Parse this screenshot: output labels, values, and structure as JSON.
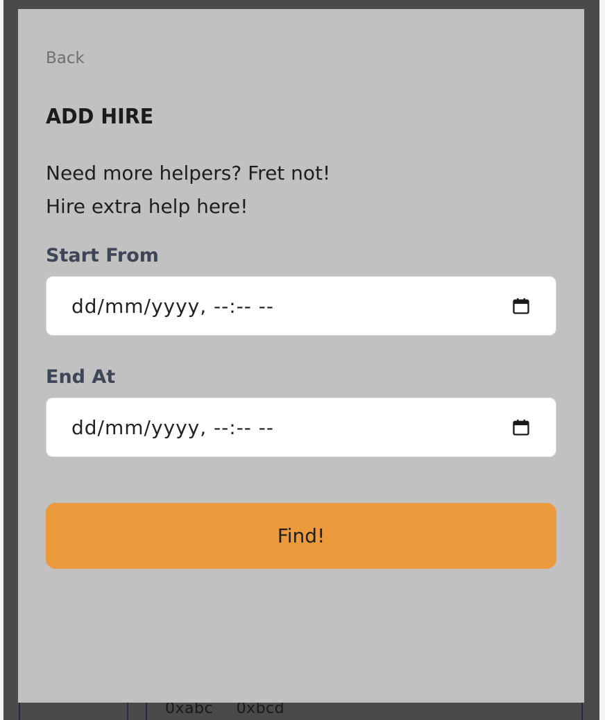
{
  "modal": {
    "back_label": "Back",
    "title": "ADD HIRE",
    "description_line1": "Need more helpers? Fret not!",
    "description_line2": "Hire extra help here!",
    "start_label": "Start From",
    "start_value": "dd/mm/yyyy, --:-- --",
    "end_label": "End At",
    "end_value": "dd/mm/yyyy, --:-- --",
    "find_label": "Find!",
    "calendar_icon": "calendar-icon"
  },
  "background": {
    "table_cells": [
      "0xabc",
      "0xbcd"
    ]
  },
  "colors": {
    "modal_bg": "#c1c1c1",
    "overlay": "#4a4a4a",
    "accent_button": "#ec9a3e",
    "label_color": "#3d4556"
  }
}
